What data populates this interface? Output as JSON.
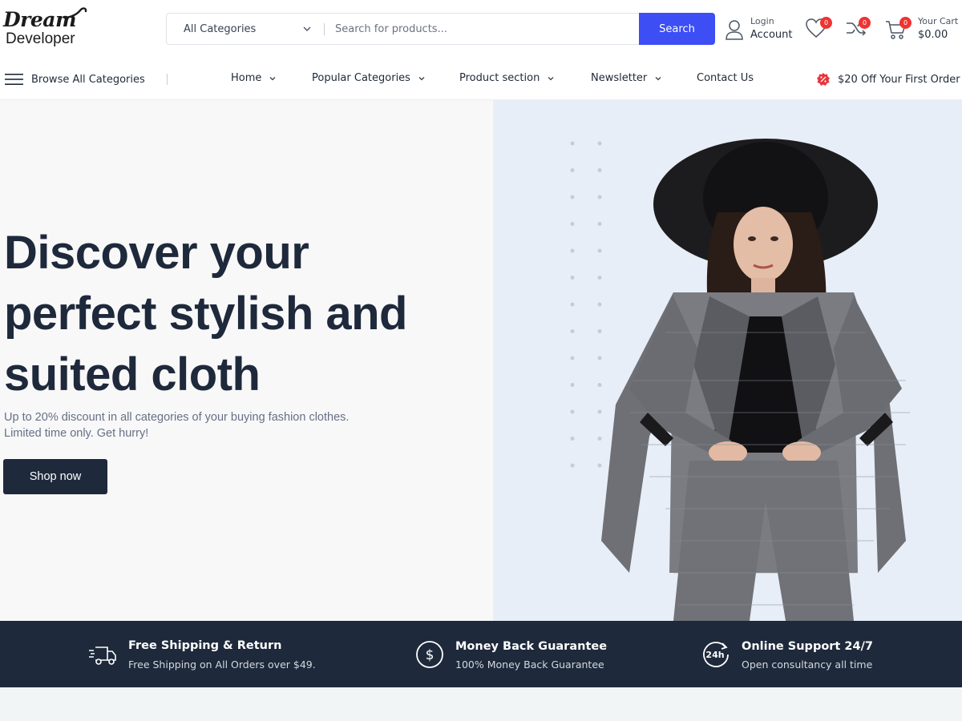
{
  "brand": {
    "logo_line1": "Dream",
    "logo_line2": "Developer"
  },
  "search": {
    "category_selected": "All Categories",
    "placeholder": "Search for products...",
    "button_label": "Search"
  },
  "account": {
    "small_label": "Login",
    "big_label": "Account"
  },
  "wishlist": {
    "count": "0"
  },
  "compare": {
    "count": "0"
  },
  "cart": {
    "count": "0",
    "label": "Your Cart",
    "total": "$0.00"
  },
  "nav": {
    "browse_label": "Browse All Categories",
    "items": [
      {
        "label": "Home"
      },
      {
        "label": "Popular Categories"
      },
      {
        "label": "Product section"
      },
      {
        "label": "Newsletter"
      },
      {
        "label": "Contact Us"
      }
    ],
    "promo": "$20 Off Your First Order"
  },
  "hero": {
    "title_lines": [
      "Discover your",
      "perfect stylish and",
      "suited cloth"
    ],
    "subtitle_lines": [
      "Up to 20% discount in all categories of your buying fashion clothes.",
      "Limited time only. Get hurry!"
    ],
    "cta_label": "Shop now"
  },
  "features": [
    {
      "icon": "delivery-truck-icon",
      "title": "Free Shipping & Return",
      "desc": "Free Shipping on All Orders over $49."
    },
    {
      "icon": "dollar-coin-icon",
      "title": "Money Back Guarantee",
      "desc": "100% Money Back Guarantee"
    },
    {
      "icon": "support-24h-icon",
      "title": "Online Support 24/7",
      "desc": "Open consultancy all time"
    }
  ],
  "colors": {
    "accent": "#3d4ef5",
    "dark": "#1e293b",
    "badge": "#e33333",
    "hero_left_bg": "#f8f8f9",
    "hero_right_bg": "#e8eef8"
  }
}
